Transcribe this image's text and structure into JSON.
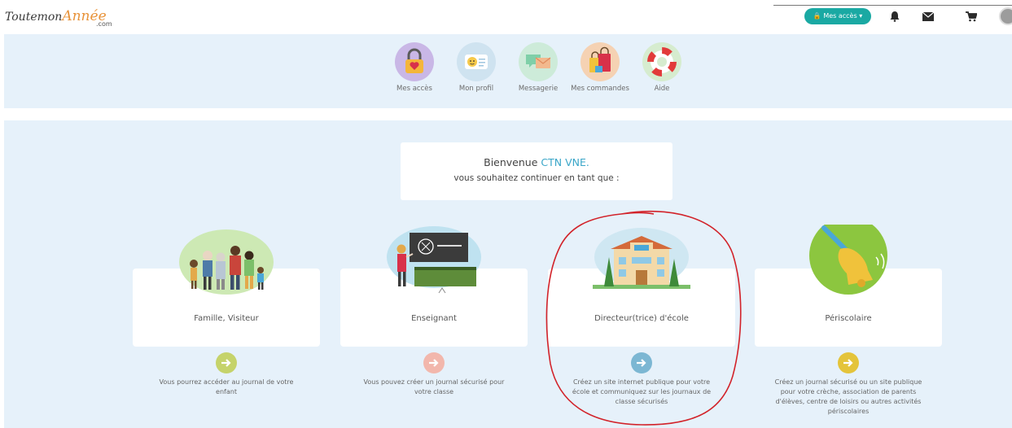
{
  "header": {
    "logo": {
      "brand": "ToutemonAnnée",
      "brand_main": "Toutemon",
      "brand_accent": "Année",
      "brand_sub": ".com"
    },
    "acces_button": "Mes accès",
    "icons": [
      "bell-icon",
      "envelope-icon",
      "cart-icon",
      "avatar"
    ]
  },
  "nav": {
    "items": [
      {
        "label": "Mes accès",
        "icon": "padlock-heart-icon",
        "color": "#c9b7e6"
      },
      {
        "label": "Mon profil",
        "icon": "profile-card-icon",
        "color": "#cfe3f0"
      },
      {
        "label": "Messagerie",
        "icon": "messages-icon",
        "color": "#cdebd9"
      },
      {
        "label": "Mes commandes",
        "icon": "shopping-bags-icon",
        "color": "#f5d2b3"
      },
      {
        "label": "Aide",
        "icon": "lifebuoy-icon",
        "color": "#d6eccf"
      }
    ]
  },
  "welcome": {
    "greeting": "Bienvenue",
    "name": "CTN VNE.",
    "prompt": "vous souhaitez continuer en tant que :"
  },
  "roles": [
    {
      "title": "Famille, Visiteur",
      "description": "Vous pourrez accéder au journal de votre enfant",
      "arrow_color": "#c5d36a",
      "illus_color": "#cde9b4"
    },
    {
      "title": "Enseignant",
      "description": "Vous pouvez créer un journal sécurisé pour votre classe",
      "arrow_color": "#f2b7ac",
      "illus_color": "#bfe2f0"
    },
    {
      "title": "Directeur(trice) d'école",
      "description": "Créez un site internet publique pour votre école et communiquez sur les journaux de classe sécurisés",
      "arrow_color": "#7cb7d3",
      "illus_color": "#cfe7f2"
    },
    {
      "title": "Périscolaire",
      "description": "Créez un journal sécurisé ou un site publique pour votre crèche, association de parents d'élèves, centre de loisirs ou autres activités périscolaires",
      "arrow_color": "#e4c43a",
      "illus_color": "#8cc63f"
    }
  ],
  "annotation_color": "#d2232a"
}
